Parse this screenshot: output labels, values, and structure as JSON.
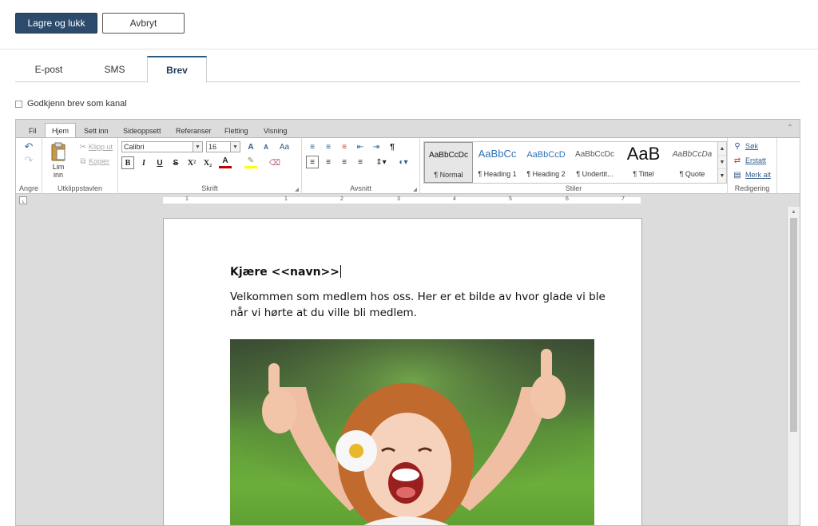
{
  "toolbar": {
    "save_label": "Lagre og lukk",
    "cancel_label": "Avbryt"
  },
  "channel_tabs": [
    {
      "label": "E-post",
      "active": false
    },
    {
      "label": "SMS",
      "active": false
    },
    {
      "label": "Brev",
      "active": true
    }
  ],
  "approve": {
    "label": "Godkjenn brev som kanal",
    "checked": false
  },
  "ribbon": {
    "tabs": [
      "Fil",
      "Hjem",
      "Sett inn",
      "Sideoppsett",
      "Referanser",
      "Fletting",
      "Visning"
    ],
    "active_tab": "Hjem",
    "groups": {
      "undo": {
        "label": "Angre"
      },
      "clipboard": {
        "label": "Utklippstavlen",
        "paste": "Lim inn",
        "cut": "Klipp ut",
        "copy": "Kopier"
      },
      "font": {
        "label": "Skrift",
        "font_name": "Calibri",
        "font_size": "16",
        "grow": "A",
        "shrink": "A",
        "case": "Aa"
      },
      "paragraph": {
        "label": "Avsnitt",
        "pilcrow": "¶"
      },
      "styles": {
        "label": "Stiler",
        "items": [
          {
            "sample": "AaBbCcDc",
            "name": "¶ Normal",
            "selected": true
          },
          {
            "sample": "AaBbCc",
            "name": "¶ Heading 1",
            "selected": false
          },
          {
            "sample": "AaBbCcD",
            "name": "¶ Heading 2",
            "selected": false
          },
          {
            "sample": "AaBbCcDc",
            "name": "¶ Undertit...",
            "selected": false
          },
          {
            "sample": "AaB",
            "name": "¶ Tittel",
            "selected": false
          },
          {
            "sample": "AaBbCcDa",
            "name": "¶ Quote",
            "selected": false
          }
        ]
      },
      "editing": {
        "label": "Redigering",
        "find": "Søk",
        "replace": "Erstatt",
        "select_all": "Merk alt"
      }
    },
    "colors": {
      "font_color_bar": "#c00000",
      "highlight_bar": "#ffff00"
    }
  },
  "ruler": {
    "numbers": [
      "1",
      "1",
      "2",
      "3",
      "4",
      "5",
      "6",
      "7"
    ]
  },
  "document": {
    "greeting": "Kjære <<navn>>",
    "body": "Velkommen som medlem hos oss. Her er et bilde av hvor glade vi ble når vi hørte at du ville bli medlem.",
    "image_description": "child-with-thumbs-up-photo"
  }
}
